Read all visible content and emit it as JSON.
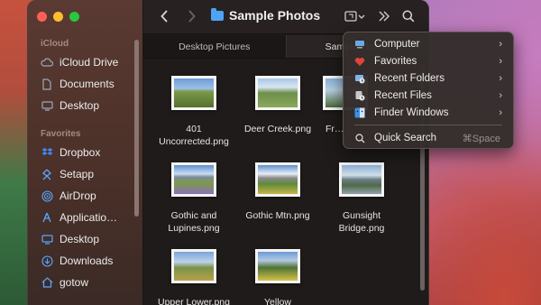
{
  "window": {
    "title": "Sample Photos"
  },
  "sidebar": {
    "sections": [
      {
        "title": "iCloud",
        "items": [
          {
            "label": "iCloud Drive",
            "icon": "cloud-icon"
          },
          {
            "label": "Documents",
            "icon": "document-icon"
          },
          {
            "label": "Desktop",
            "icon": "desktop-icon"
          }
        ]
      },
      {
        "title": "Favorites",
        "items": [
          {
            "label": "Dropbox",
            "icon": "dropbox-icon"
          },
          {
            "label": "Setapp",
            "icon": "setapp-icon"
          },
          {
            "label": "AirDrop",
            "icon": "airdrop-icon"
          },
          {
            "label": "Applicatio…",
            "icon": "applications-icon"
          },
          {
            "label": "Desktop",
            "icon": "desktop-icon"
          },
          {
            "label": "Downloads",
            "icon": "downloads-icon"
          },
          {
            "label": "gotow",
            "icon": "home-icon"
          }
        ]
      }
    ]
  },
  "tabs": [
    {
      "label": "Desktop Pictures",
      "active": false
    },
    {
      "label": "Sample Photos",
      "active": true
    }
  ],
  "files": [
    {
      "name": "401\nUncorrected.png"
    },
    {
      "name": "Deer Creek.png"
    },
    {
      "name": "Fr…"
    },
    {
      "name": "Gothic and\nLupines.png"
    },
    {
      "name": "Gothic Mtn.png"
    },
    {
      "name": "Gunsight\nBridge.png"
    },
    {
      "name": "Upper Lower.png"
    },
    {
      "name": "Yellow"
    }
  ],
  "menu": {
    "items": [
      {
        "label": "Computer",
        "icon": "computer-icon",
        "submenu": true
      },
      {
        "label": "Favorites",
        "icon": "heart-icon",
        "submenu": true
      },
      {
        "label": "Recent Folders",
        "icon": "recent-folders-icon",
        "submenu": true
      },
      {
        "label": "Recent Files",
        "icon": "recent-files-icon",
        "submenu": true
      },
      {
        "label": "Finder Windows",
        "icon": "finder-icon",
        "submenu": true
      }
    ],
    "quick_search": {
      "label": "Quick Search",
      "shortcut": "⌘Space"
    }
  },
  "colors": {
    "accent": "#4fa3f7",
    "close": "#ff5f57",
    "minimize": "#febc2e",
    "maximize": "#28c840"
  }
}
